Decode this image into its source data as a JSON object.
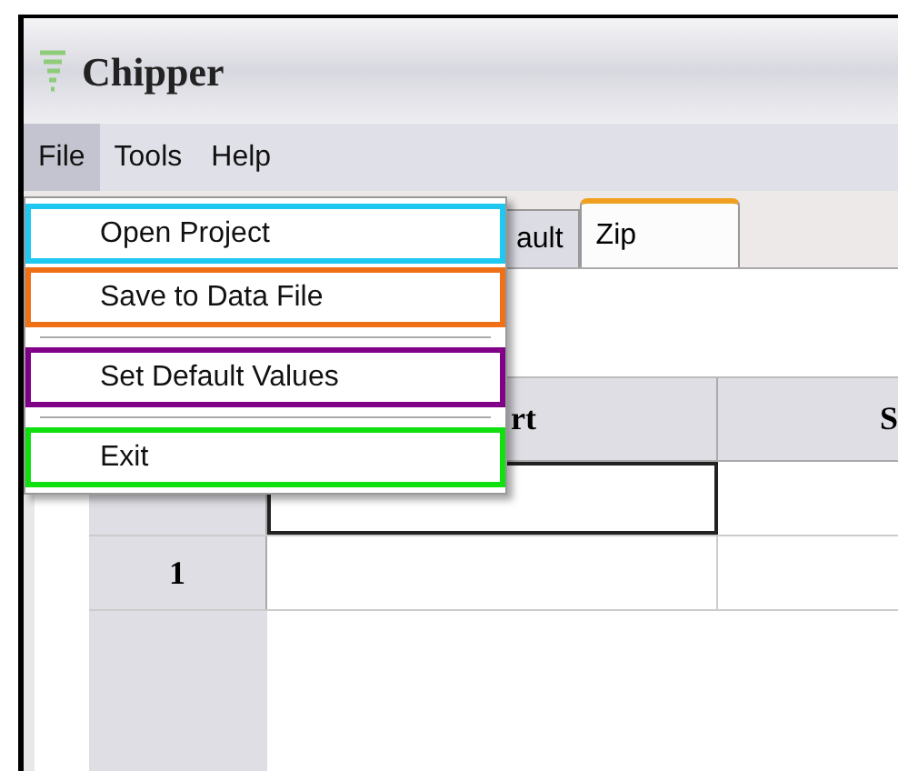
{
  "window": {
    "title": "Chipper"
  },
  "menu_bar": [
    {
      "label": "File",
      "selected": true
    },
    {
      "label": "Tools",
      "selected": false
    },
    {
      "label": "Help",
      "selected": false
    }
  ],
  "tabs": [
    {
      "label": "ault",
      "selected": false
    },
    {
      "label": "Zip",
      "selected": true
    }
  ],
  "table": {
    "columns": [
      "rt",
      "S"
    ],
    "rows": [
      {
        "header": "",
        "editing": true
      },
      {
        "header": "1",
        "editing": false
      }
    ]
  },
  "file_menu": [
    {
      "kind": "item",
      "label": "Open Project",
      "color": "#1ec8f0"
    },
    {
      "kind": "item",
      "label": "Save to Data File",
      "color": "#f07018"
    },
    {
      "kind": "separator"
    },
    {
      "kind": "item",
      "label": "Set Default Values",
      "color": "#800088"
    },
    {
      "kind": "separator"
    },
    {
      "kind": "item",
      "label": "Exit",
      "color": "#10e010"
    }
  ]
}
